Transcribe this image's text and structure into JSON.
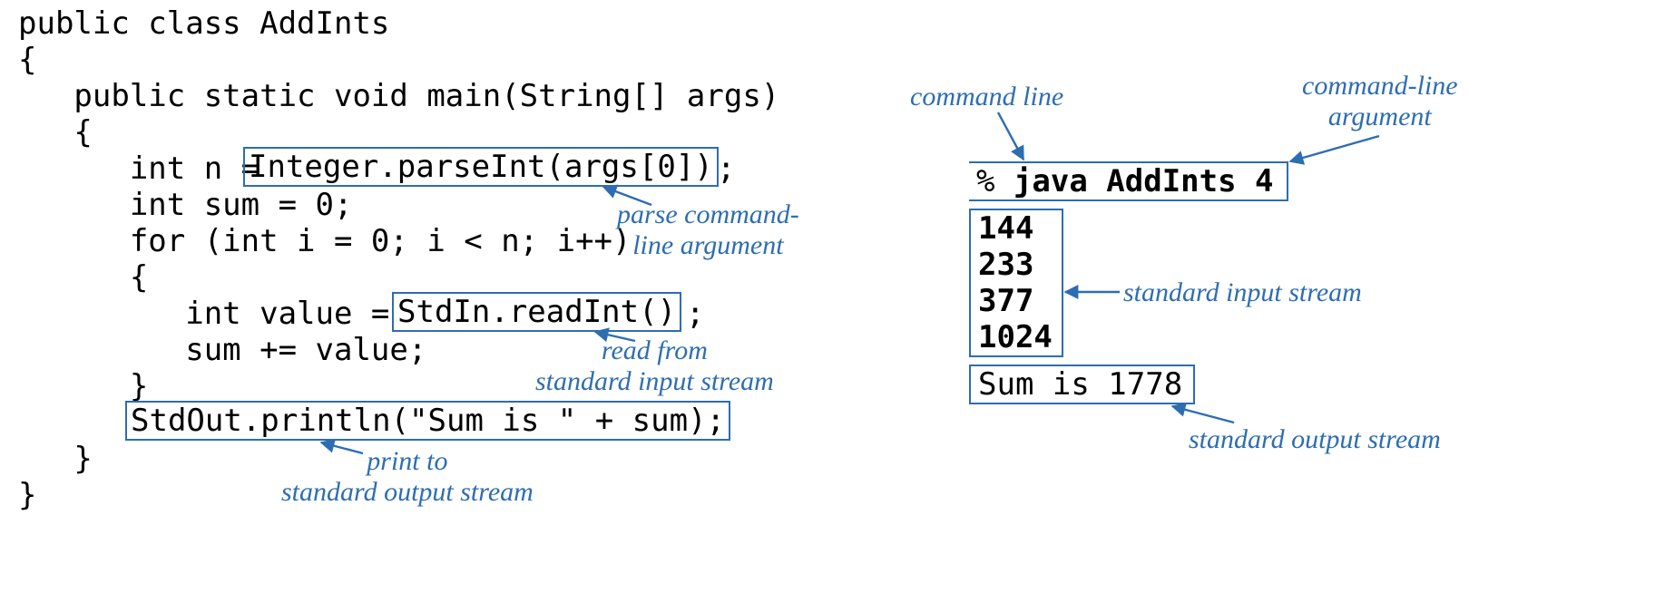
{
  "code": {
    "l1": "public class AddInts",
    "l2": "{",
    "l3": "   public static void main(String[] args)",
    "l4": "   {",
    "l5a": "      int n = ",
    "boxed_parse": "Integer.parseInt(args[0])",
    "l5b": ";",
    "l6": "      int sum = 0;",
    "l7": "      for (int i = 0; i < n; i++)",
    "l8": "      {",
    "l9a": "         int value = ",
    "boxed_read": "StdIn.readInt()",
    "l9b": ";",
    "l10": "         sum += value;",
    "l11": "      }",
    "boxed_print": "StdOut.println(\"Sum is \" + sum);",
    "l13": "   }",
    "l14": "}"
  },
  "annotations": {
    "parse_cmdline": "parse command-\nline argument",
    "read_stdin": "read from\nstandard input stream",
    "print_stdout": "print to\nstandard output stream",
    "command_line": "command line",
    "cmdline_argument": "command-line\nargument",
    "stdin_stream": "standard input stream",
    "stdout_stream": "standard output stream"
  },
  "terminal": {
    "cmd_prompt": "% ",
    "cmd_text": "java AddInts 4",
    "inputs": [
      "144",
      "233",
      "377",
      "1024"
    ],
    "output": "Sum is 1778"
  },
  "colors": {
    "annotation_blue": "#2d6db2",
    "code_black": "#000000"
  }
}
